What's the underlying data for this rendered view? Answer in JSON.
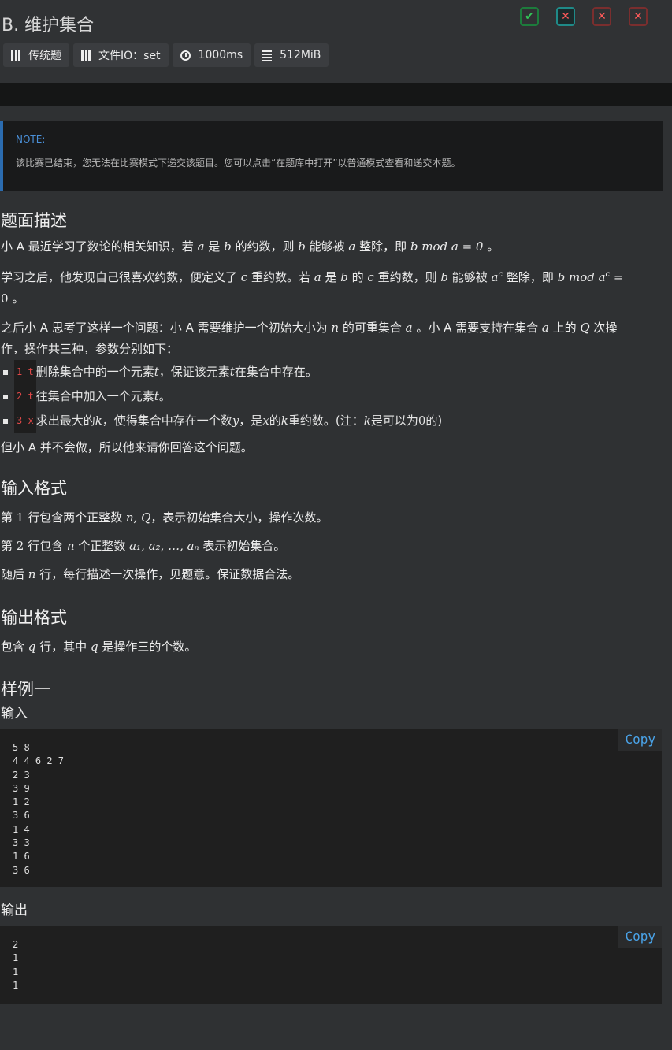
{
  "title": "B. 维护集合",
  "tags": {
    "type": "传统题",
    "io": "文件IO：set",
    "time": "1000ms",
    "memory": "512MiB"
  },
  "status_colors": {
    "ok": "#34c759",
    "err": "#ff5a5a"
  },
  "note": {
    "title": "NOTE:",
    "text": "该比赛已结束，您无法在比赛模式下递交该题目。您可以点击“在题库中打开”以普通模式查看和递交本题。"
  },
  "description": {
    "heading": "题面描述",
    "p1": {
      "a": "小 A 最近学习了数论的相关知识，若 ",
      "b": " 是 ",
      "c": " 的约数，则 ",
      "d": " 能够被 ",
      "e": " 整除，即 ",
      "f": " 。"
    },
    "p2": {
      "a": "学习之后，他发现自己很喜欢约数，便定义了 ",
      "b": " 重约数。若 ",
      "c": " 是 ",
      "d": " 的 ",
      "e": " 重约数，则 ",
      "f": " 能够被 ",
      "g": " 整除，即 "
    },
    "p3": {
      "a": "之后小 A 思考了这样一个问题：小 A 需要维护一个初始大小为 ",
      "b": " 的可重集合 ",
      "c": " 。小 A 需要支持在集合 ",
      "d": " 上的 ",
      "e": " 次操",
      "f": "作，操作共三种，参数分别如下："
    },
    "ops": [
      {
        "code": "1 t",
        "a": "删除集合中的一个元素 ",
        "b": " ，保证该元素 ",
        "c": " 在集合中存在。"
      },
      {
        "code": "2 t",
        "a": "往集合中加入一个元素 ",
        "b": " 。"
      },
      {
        "code": "3 x",
        "a": "求出最大的 ",
        "b": " ，使得集合中存在一个数 ",
        "c": "，是 ",
        "d": " 的 ",
        "e": " 重约数。(注：",
        "f": " 是可以为 ",
        "g": " 的)"
      }
    ],
    "p4": "但小 A 并不会做，所以他来请你回答这个问题。"
  },
  "input": {
    "heading": "输入格式",
    "l1": {
      "a": "第 ",
      "b": " 行包含两个正整数 ",
      "c": "，表示初始集合大小，操作次数。"
    },
    "l2": {
      "a": "第 ",
      "b": " 行包含 ",
      "c": " 个正整数 ",
      "d": " 表示初始集合。"
    },
    "l3": {
      "a": "随后 ",
      "b": " 行，每行描述一次操作，见题意。保证数据合法。"
    }
  },
  "output": {
    "heading": "输出格式",
    "l1": {
      "a": "包含 ",
      "b": " 行，其中 ",
      "c": " 是操作三的个数。"
    }
  },
  "math": {
    "a": "a",
    "b": "b",
    "c": "c",
    "n": "n",
    "Q": "Q",
    "t": "t",
    "k": "k",
    "y": "y",
    "x": "x",
    "q": "q",
    "zero": "0",
    "one": "1",
    "two": "2",
    "mod1": "b mod a = 0",
    "mod2_pre": "b mod a",
    "mod2_sup": "c",
    "mod2_post": " =",
    "ac_base": "a",
    "ac_sup": "c",
    "nQ": "n, Q",
    "seq": "a₁, a₂, …, aₙ"
  },
  "sample": {
    "heading": "样例一",
    "input_label": "输入",
    "output_label": "输出",
    "copy_label": "Copy",
    "input_lines": [
      "5 8",
      "4 4 6 2 7",
      "2 3",
      "3 9",
      "1 2",
      "3 6",
      "1 4",
      "3 3",
      "1 6",
      "3 6"
    ],
    "output_lines": [
      "2",
      "1",
      "1",
      "1"
    ]
  }
}
